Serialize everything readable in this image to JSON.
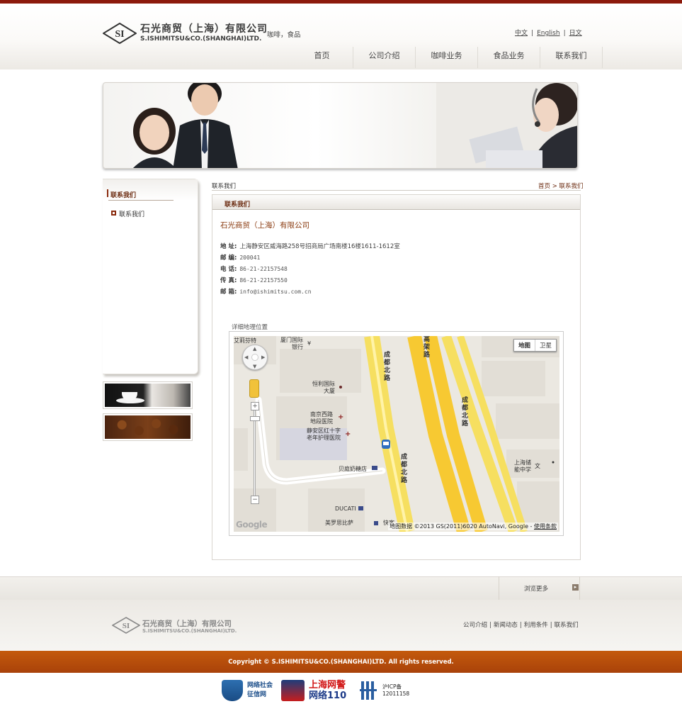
{
  "header": {
    "company_cn": "石光商贸（上海）有限公司",
    "company_en": "S.ISHIMITSU&CO.(SHANGHAI)LTD.",
    "logo_letters": "SI",
    "tagline": "咖啡，食品",
    "languages": [
      "中文",
      "English",
      "日文"
    ],
    "lang_separator": "|"
  },
  "nav": {
    "items": [
      "首页",
      "公司介绍",
      "咖啡业务",
      "食品业务",
      "联系我们"
    ]
  },
  "sidebar": {
    "title": "联系我们",
    "items": [
      "联系我们"
    ]
  },
  "breadcrumb": {
    "current": "联系我们",
    "home": "首页",
    "separator": ">",
    "trail_current": "联系我们"
  },
  "content": {
    "header_title": "联系我们",
    "company_name": "石光商贸（上海）有限公司",
    "info": [
      {
        "label": "地 址:",
        "value": "上海静安区威海路258号招商局广场南楼16楼1611-1612室"
      },
      {
        "label": "邮 编:",
        "value": "200041"
      },
      {
        "label": "电 话:",
        "value": "86-21-22157548"
      },
      {
        "label": "传 真:",
        "value": "86-21-22157550"
      },
      {
        "label": "邮 箱:",
        "value": "info@ishimitsu.com.cn"
      }
    ],
    "map_title": "详细地理位置"
  },
  "map": {
    "types": [
      "地图",
      "卫星"
    ],
    "labels": {
      "top_left": "艾莉芬特",
      "gate1": "厦门国际",
      "gate2": "银行",
      "henglili1": "恒利国际",
      "henglili2": "大厦",
      "hosp1": "南京西路",
      "hosp2": "地段医院",
      "nurse1": "静安区红十字",
      "nurse2": "老年护理医院",
      "beiting": "贝庭奶糖店",
      "ducati": "DUCATI",
      "meiluo": "美罗思比萨",
      "kuaike": "快客",
      "school1": "上海储",
      "school2": "能中学",
      "school_mark": "文",
      "road_chengdu": "成都北路",
      "road_gaojia": "高架路",
      "yen_mark": "¥"
    },
    "zoom_in": "+",
    "zoom_out": "−",
    "logo": "Google",
    "attribution": "地图数据 ©2013 GS(2011)6020 AutoNavi, Google - ",
    "terms": "使用条款"
  },
  "footer": {
    "more_label": "浏览更多",
    "more_icon": "▸",
    "company_cn": "石光商贸（上海）有限公司",
    "company_en": "S.ISHIMITSU&CO.(SHANGHAI)LTD.",
    "links": [
      "公司介绍",
      "新闻动态",
      "利用条件",
      "联系我们"
    ],
    "copyright": "Copyright © S.ISHIMITSU&CO.(SHANGHAI)LTD. All rights reserved.",
    "badges": {
      "b1_line1": "网络社会",
      "b1_line2": "征信网",
      "b2_line1": "上海网警",
      "b2_line2": "网络110",
      "b3_line1": "沪ICP备",
      "b3_line2": "12011158"
    }
  },
  "colors": {
    "brand_dark_red": "#8c1a0c",
    "copyright_bar": "#b84c0b",
    "title_brown": "#6b2b10"
  }
}
